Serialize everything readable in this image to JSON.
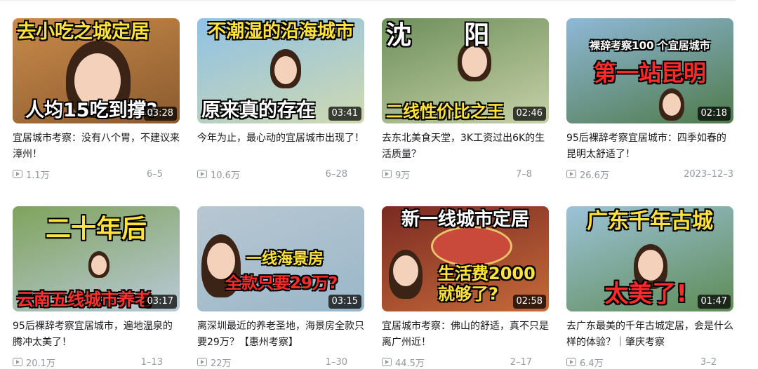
{
  "videos": [
    {
      "thumb_top": "去小吃之城定居",
      "thumb_bottom": "人均15吃到撑?",
      "duration": "03:28",
      "title": "宜居城市考察：没有八个胃，不建议来漳州！",
      "views": "1.1万",
      "date": "6–5",
      "bg": "#c98a4a",
      "bg2": "#8a5a2e",
      "top_color": "#ffe23a",
      "bottom_color": "#ffffff"
    },
    {
      "thumb_top": "不潮湿的沿海城市",
      "thumb_bottom": "原来真的存在",
      "duration": "03:41",
      "title": "今年为止，最心动的宜居城市出现了！",
      "views": "10.6万",
      "date": "6–28",
      "bg": "#8fc1e6",
      "bg2": "#cfd9b0",
      "top_color": "#ffe23a",
      "bottom_color": "#ffffff"
    },
    {
      "thumb_top": "沈      阳",
      "thumb_bottom": "二线性价比之王",
      "duration": "02:46",
      "title": "去东北美食天堂，3K工资过出6K的生活质量？",
      "views": "9万",
      "date": "7–8",
      "bg": "#6d8f5a",
      "bg2": "#c7d1a8",
      "top_color": "#ffffff",
      "bottom_color": "#ffe23a"
    },
    {
      "thumb_top": "裸辞考察100 个宜居城市",
      "thumb_bottom": "第一站昆明",
      "duration": "02:18",
      "title": "95后裸辞考察宜居城市：四季如春的昆明太舒适了！",
      "views": "26.6万",
      "date": "2023–12–3",
      "bg": "#8fb8d8",
      "bg2": "#4f7a4a",
      "top_color": "#ffffff",
      "bottom_color": "#ff2a2a"
    },
    {
      "thumb_top": "二十年后",
      "thumb_bottom": "云南五线城市养老",
      "duration": "03:17",
      "title": "95后裸辞考察宜居城市，遍地温泉的腾冲太美了！",
      "views": "20.1万",
      "date": "1–13",
      "bg": "#7fa35c",
      "bg2": "#b9c9d8",
      "top_color": "#ffe23a",
      "bottom_color": "#ff3030"
    },
    {
      "thumb_top": "一线海景房",
      "thumb_bottom": "全款只要29万?",
      "duration": "03:15",
      "title": "离深圳最近的养老圣地，海景房全款只要29万？【惠州考察】",
      "views": "22万",
      "date": "1–30",
      "bg": "#b8c7d2",
      "bg2": "#9ab7c9",
      "top_color": "#ffe23a",
      "bottom_color": "#ff2a2a"
    },
    {
      "thumb_top": "新一线城市定居",
      "thumb_bottom": "生活费2000 就够了?",
      "duration": "02:58",
      "title": "宜居城市考察：佛山的舒适，真不只是离广州近！",
      "views": "44.5万",
      "date": "2–17",
      "bg": "#7a2a22",
      "bg2": "#c66a3a",
      "top_color": "#ffffff",
      "bottom_color": "#ffe23a"
    },
    {
      "thumb_top": "广东千年古城",
      "thumb_bottom": "太美了!",
      "duration": "01:47",
      "title": "去广东最美的千年古城定居，会是什么样的体验？｜肇庆考察",
      "views": "6.4万",
      "date": "3–2",
      "bg": "#9cc3d9",
      "bg2": "#5e8b55",
      "top_color": "#ffe23a",
      "bottom_color": "#ff2a2a"
    }
  ]
}
